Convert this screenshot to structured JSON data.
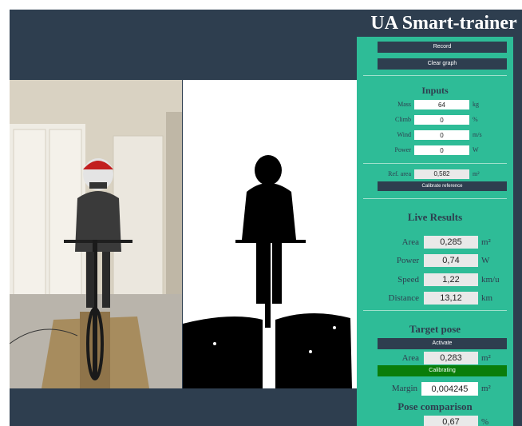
{
  "app": {
    "title": "UA Smart-trainer"
  },
  "controls": {
    "record_label": "Record",
    "clear_graph_label": "Clear graph"
  },
  "inputs": {
    "title": "Inputs",
    "fields": [
      {
        "label": "Mass",
        "value": "64",
        "unit": "kg"
      },
      {
        "label": "Climb",
        "value": "0",
        "unit": "%"
      },
      {
        "label": "Wind",
        "value": "0",
        "unit": "m/s"
      },
      {
        "label": "Power",
        "value": "0",
        "unit": "W"
      }
    ],
    "ref_area": {
      "label": "Ref. area",
      "value": "0,582",
      "unit": "m²"
    },
    "calibrate_label": "Calibrate reference"
  },
  "live_results": {
    "title": "Live Results",
    "rows": [
      {
        "label": "Area",
        "value": "0,285",
        "unit": "m²"
      },
      {
        "label": "Power",
        "value": "0,74",
        "unit": "W"
      },
      {
        "label": "Speed",
        "value": "1,22",
        "unit": "km/u"
      },
      {
        "label": "Distance",
        "value": "13,12",
        "unit": "km"
      }
    ]
  },
  "target_pose": {
    "title": "Target pose",
    "activate_label": "Activate",
    "area": {
      "label": "Area",
      "value": "0,283",
      "unit": "m²"
    },
    "status_label": "Calibrating",
    "margin": {
      "label": "Margin",
      "value": "0,004245",
      "unit": "m²"
    }
  },
  "pose_comparison": {
    "title": "Pose comparison",
    "value": "0,67",
    "unit": "%"
  },
  "colors": {
    "background": "#2e3e4f",
    "panel": "#2ebc97",
    "button": "#2e3e4f",
    "status_green": "#0a7d0a"
  }
}
